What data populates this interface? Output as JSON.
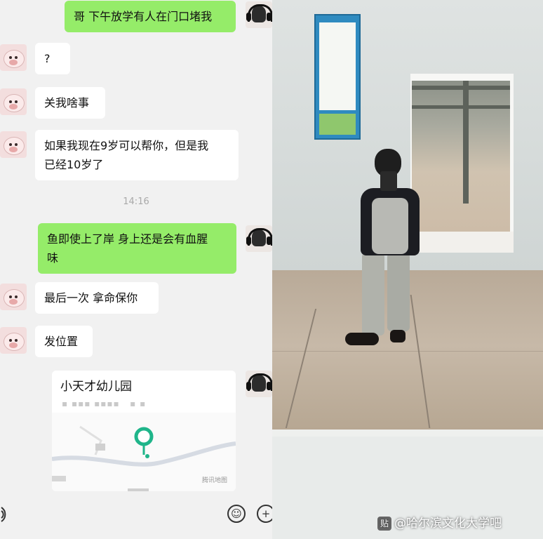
{
  "chat": {
    "messages": [
      {
        "from": "me",
        "text": "哥 下午放学有人在门口堵我"
      },
      {
        "from": "them",
        "text": "?"
      },
      {
        "from": "them",
        "text": "关我啥事"
      },
      {
        "from": "them",
        "lines": [
          "如果我现在9岁可以帮你，但是我",
          "已经10岁了"
        ]
      },
      {
        "from": "me",
        "lines": [
          "鱼即使上了岸 身上还是会有血腥",
          "味"
        ]
      },
      {
        "from": "them",
        "text": "最后一次 拿命保你"
      },
      {
        "from": "them",
        "text": "发位置"
      }
    ],
    "timestamp": "14:16",
    "location": {
      "title": "小天才幼儿园",
      "map_label": "腾讯地图"
    },
    "toolbar": {
      "voice_icon": "voice-icon",
      "emoji_icon": "emoji-icon",
      "plus_icon": "plus-icon"
    }
  },
  "watermark": {
    "badge": "贴",
    "text": "@哈尔滨文化大学吧"
  },
  "colors": {
    "outgoing_bubble": "#95ec69",
    "incoming_bubble": "#ffffff",
    "chat_bg": "#f1f1f1"
  }
}
